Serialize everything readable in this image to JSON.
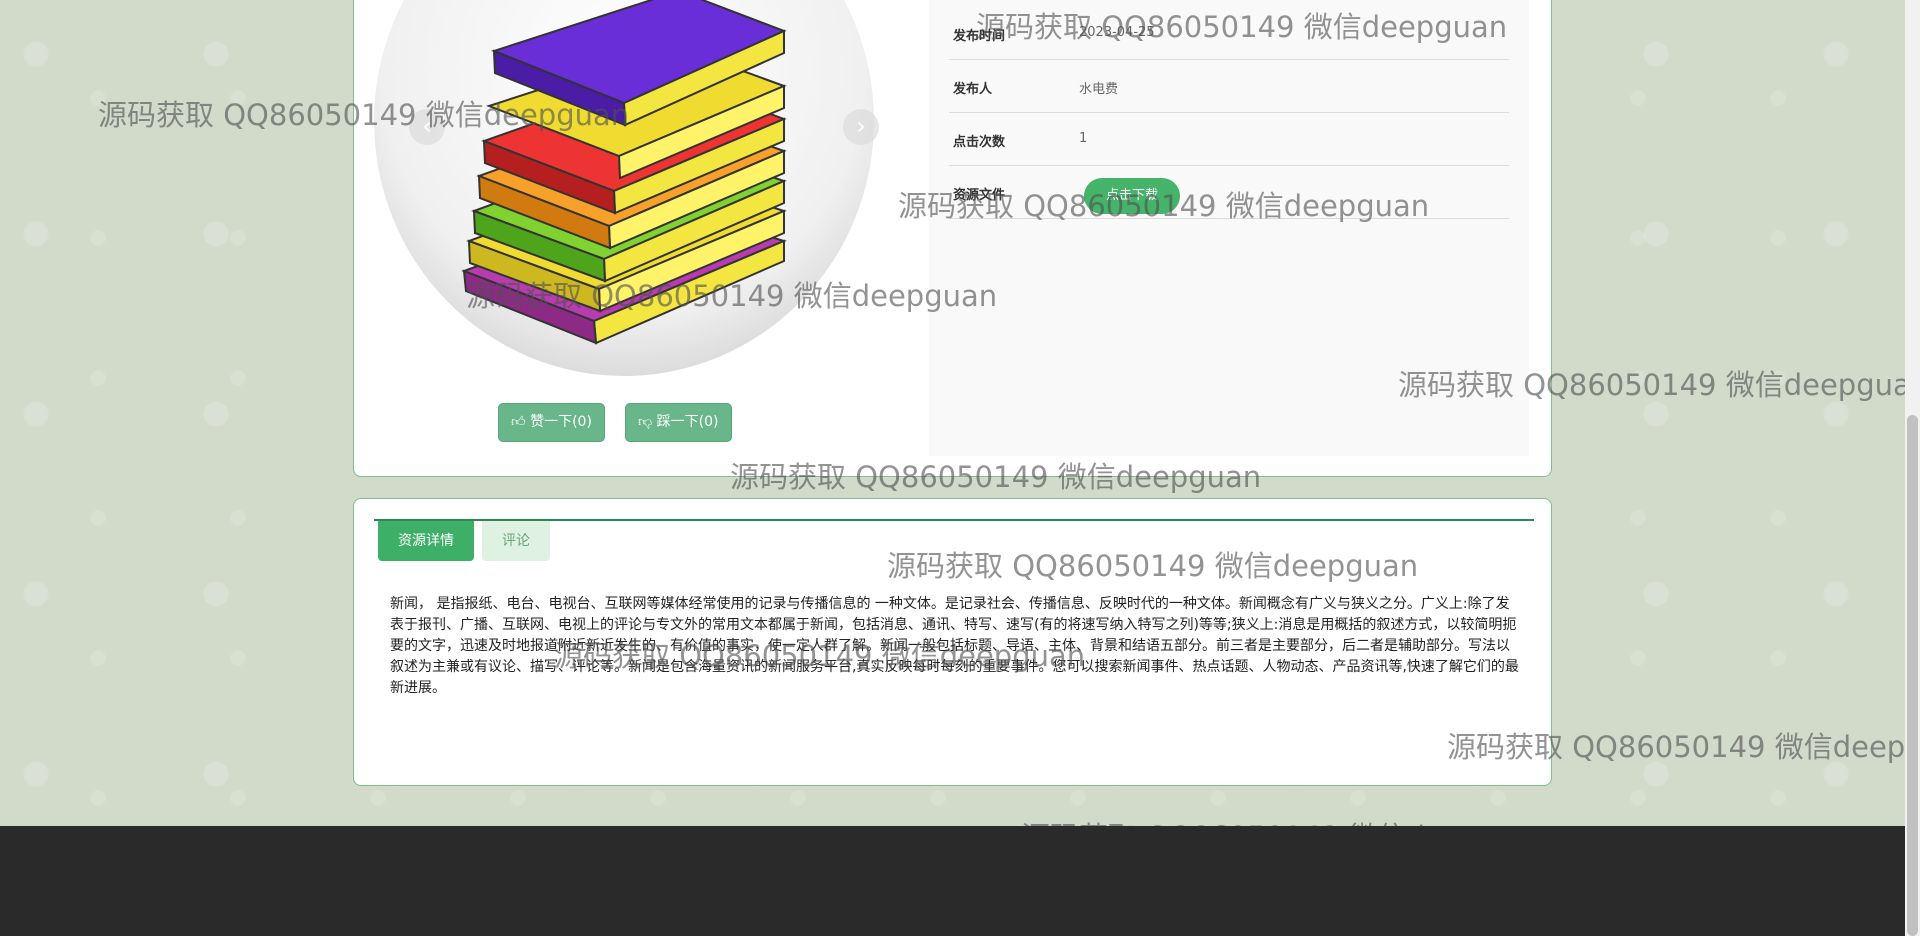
{
  "info": {
    "rows": [
      {
        "key": "发布时间",
        "value": "2023-04-25"
      },
      {
        "key": "发布人",
        "value": "水电费"
      },
      {
        "key": "点击次数",
        "value": "1"
      },
      {
        "key": "资源文件",
        "value": ""
      }
    ],
    "download_label": "点击下载"
  },
  "votes": {
    "up": "赞一下(0)",
    "down": "踩一下(0)",
    "up_icon": "thumbs-up-icon",
    "down_icon": "thumbs-down-icon"
  },
  "carousel": {
    "prev": "‹",
    "next": "›"
  },
  "tabs": {
    "detail": "资源详情",
    "comments": "评论"
  },
  "description": "新闻， 是指报纸、电台、电视台、互联网等媒体经常使用的记录与传播信息的 一种文体。是记录社会、传播信息、反映时代的一种文体。新闻概念有广义与狭义之分。广义上:除了发表于报刊、广播、互联网、电视上的评论与专文外的常用文本都属于新闻，包括消息、通讯、特写、速写(有的将速写纳入特写之列)等等;狭义上:消息是用概括的叙述方式，以较简明扼要的文字，迅速及时地报道附近新近发生的、有价值的事实，使一定人群了解。新闻一般包括标题、导语、主体、背景和结语五部分。前三者是主要部分，后二者是辅助部分。写法以叙述为主兼或有议论、描写、评论等。新闻是包含海量资讯的新闻服务平台,真实反映每时每刻的重要事件。您可以搜索新闻事件、热点话题、人物动态、产品资讯等,快速了解它们的最新进展。",
  "watermark": "源码获取 QQ86050149 微信deepguan",
  "colors": {
    "accent": "#3daf67",
    "footer": "#2a2a2a",
    "border": "#7cc08b"
  }
}
